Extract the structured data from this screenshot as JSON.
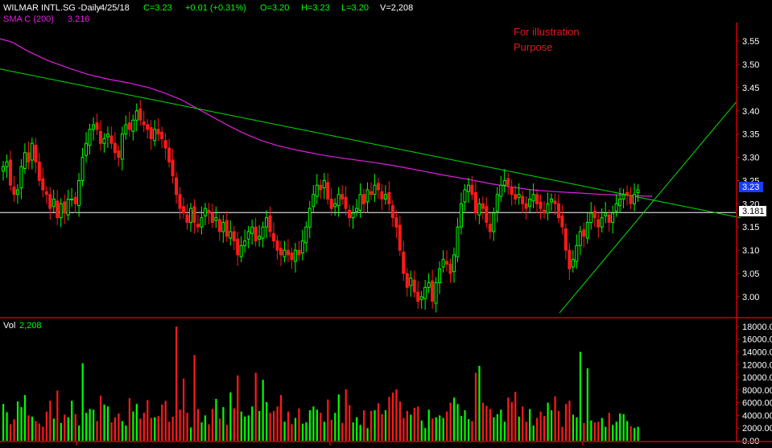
{
  "header": {
    "symbol": "WILMAR INTL.SG -Daily",
    "date": "4/25/18",
    "close": "C=3.23",
    "change": "+0.01 (+0.31%)",
    "open": "O=3.20",
    "high": "H=3.23",
    "low": "L=3.20",
    "volume": "V=2,208"
  },
  "sma_label": "SMA C (200)",
  "sma_value": "3.216",
  "annotation": {
    "line1": "For illustration",
    "line2": "Purpose"
  },
  "volume_label": "Vol",
  "volume_value": "2,208",
  "price_labels": {
    "last": "3.23",
    "horizontal_line": "3.181"
  },
  "colors": {
    "up": "#00ff00",
    "down": "#ff1a1a",
    "sma": "#e020e0",
    "trendline": "#00e000",
    "frame": "#cc0000",
    "last_price_bg": "#1a3cff"
  },
  "chart_data": [
    {
      "type": "candlestick",
      "title": "WILMAR INTL.SG -Daily",
      "ylim": [
        2.96,
        3.59
      ],
      "yticks": [
        "3.55",
        "3.50",
        "3.45",
        "3.40",
        "3.35",
        "3.30",
        "3.25",
        "3.20",
        "3.15",
        "3.10",
        "3.05",
        "3.00"
      ],
      "horizontal_line": 3.181,
      "close": [
        3.28,
        3.29,
        3.24,
        3.22,
        3.23,
        3.28,
        3.31,
        3.29,
        3.33,
        3.29,
        3.25,
        3.23,
        3.22,
        3.19,
        3.21,
        3.17,
        3.2,
        3.18,
        3.21,
        3.21,
        3.2,
        3.25,
        3.3,
        3.33,
        3.36,
        3.37,
        3.36,
        3.33,
        3.34,
        3.35,
        3.33,
        3.31,
        3.3,
        3.35,
        3.37,
        3.36,
        3.38,
        3.4,
        3.38,
        3.37,
        3.36,
        3.34,
        3.36,
        3.35,
        3.34,
        3.32,
        3.29,
        3.26,
        3.22,
        3.19,
        3.18,
        3.16,
        3.19,
        3.16,
        3.15,
        3.17,
        3.19,
        3.18,
        3.16,
        3.17,
        3.14,
        3.16,
        3.13,
        3.14,
        3.12,
        3.09,
        3.11,
        3.12,
        3.14,
        3.15,
        3.12,
        3.13,
        3.15,
        3.17,
        3.14,
        3.12,
        3.1,
        3.09,
        3.1,
        3.09,
        3.08,
        3.1,
        3.09,
        3.12,
        3.15,
        3.19,
        3.22,
        3.24,
        3.23,
        3.25,
        3.21,
        3.19,
        3.2,
        3.22,
        3.21,
        3.19,
        3.17,
        3.18,
        3.19,
        3.22,
        3.2,
        3.23,
        3.22,
        3.24,
        3.23,
        3.21,
        3.22,
        3.2,
        3.17,
        3.15,
        3.1,
        3.05,
        3.02,
        3.04,
        3.01,
        2.99,
        3.0,
        3.02,
        3.03,
        2.99,
        3.03,
        3.06,
        3.08,
        3.07,
        3.05,
        3.09,
        3.15,
        3.2,
        3.23,
        3.24,
        3.22,
        3.18,
        3.2,
        3.19,
        3.16,
        3.14,
        3.18,
        3.22,
        3.24,
        3.25,
        3.24,
        3.22,
        3.21,
        3.22,
        3.2,
        3.19,
        3.21,
        3.22,
        3.2,
        3.19,
        3.18,
        3.2,
        3.21,
        3.2,
        3.17,
        3.15,
        3.1,
        3.06,
        3.08,
        3.11,
        3.14,
        3.13,
        3.16,
        3.18,
        3.17,
        3.15,
        3.17,
        3.18,
        3.16,
        3.18,
        3.2,
        3.21,
        3.22,
        3.22,
        3.2,
        3.22,
        3.23
      ]
    },
    {
      "type": "line",
      "name": "SMA C (200)",
      "points": [
        [
          0,
          3.555
        ],
        [
          15,
          3.548
        ],
        [
          35,
          3.528
        ],
        [
          60,
          3.508
        ],
        [
          85,
          3.492
        ],
        [
          110,
          3.478
        ],
        [
          135,
          3.468
        ],
        [
          160,
          3.46
        ],
        [
          185,
          3.45
        ],
        [
          205,
          3.438
        ],
        [
          225,
          3.424
        ],
        [
          245,
          3.405
        ],
        [
          265,
          3.386
        ],
        [
          285,
          3.367
        ],
        [
          305,
          3.35
        ],
        [
          325,
          3.336
        ],
        [
          345,
          3.325
        ],
        [
          370,
          3.315
        ],
        [
          400,
          3.305
        ],
        [
          430,
          3.297
        ],
        [
          460,
          3.29
        ],
        [
          490,
          3.282
        ],
        [
          520,
          3.272
        ],
        [
          550,
          3.262
        ],
        [
          580,
          3.253
        ],
        [
          610,
          3.243
        ],
        [
          635,
          3.236
        ],
        [
          660,
          3.23
        ],
        [
          690,
          3.226
        ],
        [
          720,
          3.223
        ],
        [
          750,
          3.22
        ],
        [
          780,
          3.218
        ],
        [
          810,
          3.216
        ]
      ]
    },
    {
      "type": "line",
      "name": "trendline",
      "points": [
        [
          0,
          3.49
        ],
        [
          920,
          3.17
        ]
      ]
    },
    {
      "type": "line",
      "name": "trendline",
      "points": [
        [
          695,
          2.965
        ],
        [
          915,
          3.42
        ]
      ]
    },
    {
      "type": "bar",
      "title": "Vol",
      "ylim": [
        0,
        19000
      ],
      "yticks": [
        "0.00",
        "2000.00",
        "4000.00",
        "6000.00",
        "8000.00",
        "10000.00",
        "12000.00",
        "14000.00",
        "16000.00",
        "18000.00"
      ],
      "values": [
        5800,
        4500,
        2600,
        3400,
        6200,
        5300,
        7200,
        4000,
        3800,
        3100,
        2700,
        2200,
        4600,
        6300,
        3500,
        7900,
        2800,
        4100,
        3700,
        6300,
        4200,
        2400,
        12200,
        4400,
        5000,
        4900,
        3100,
        7100,
        5700,
        5400,
        2900,
        3700,
        4300,
        3100,
        2400,
        6700,
        4600,
        5800,
        3500,
        4400,
        6400,
        3600,
        3700,
        3900,
        5700,
        6300,
        3000,
        3800,
        18000,
        4900,
        9800,
        4400,
        2100,
        13500,
        5000,
        2900,
        4000,
        2600,
        5000,
        6600,
        3500,
        5300,
        2500,
        7600,
        5100,
        10300,
        4600,
        3800,
        4000,
        5400,
        10700,
        4700,
        9600,
        6100,
        4400,
        4700,
        5400,
        7200,
        3000,
        4600,
        2600,
        3600,
        5100,
        2700,
        2900,
        4800,
        5400,
        4900,
        4400,
        3000,
        6500,
        3300,
        4400,
        7300,
        2800,
        8100,
        5600,
        2900,
        3700,
        2500,
        4800,
        2000,
        4700,
        4800,
        5900,
        4200,
        4800,
        6900,
        7600,
        8100,
        6200,
        3600,
        4700,
        4100,
        5200,
        5400,
        3200,
        2000,
        4900,
        3500,
        3700,
        4000,
        3600,
        4600,
        6000,
        6800,
        5800,
        3900,
        4800,
        3400,
        3100,
        10700,
        11800,
        6000,
        5500,
        5000,
        3700,
        4200,
        4900,
        3000,
        6800,
        6100,
        7700,
        3800,
        5400,
        3000,
        5000,
        2400,
        3600,
        4600,
        3900,
        6000,
        4800,
        7000,
        4700,
        2200,
        5800,
        6300,
        4100,
        3700,
        14000,
        2800,
        11400,
        3200,
        2900,
        3000,
        3600,
        2200,
        4400,
        2500,
        3000,
        4300,
        4200,
        3100,
        2300,
        2000,
        2208
      ]
    }
  ]
}
